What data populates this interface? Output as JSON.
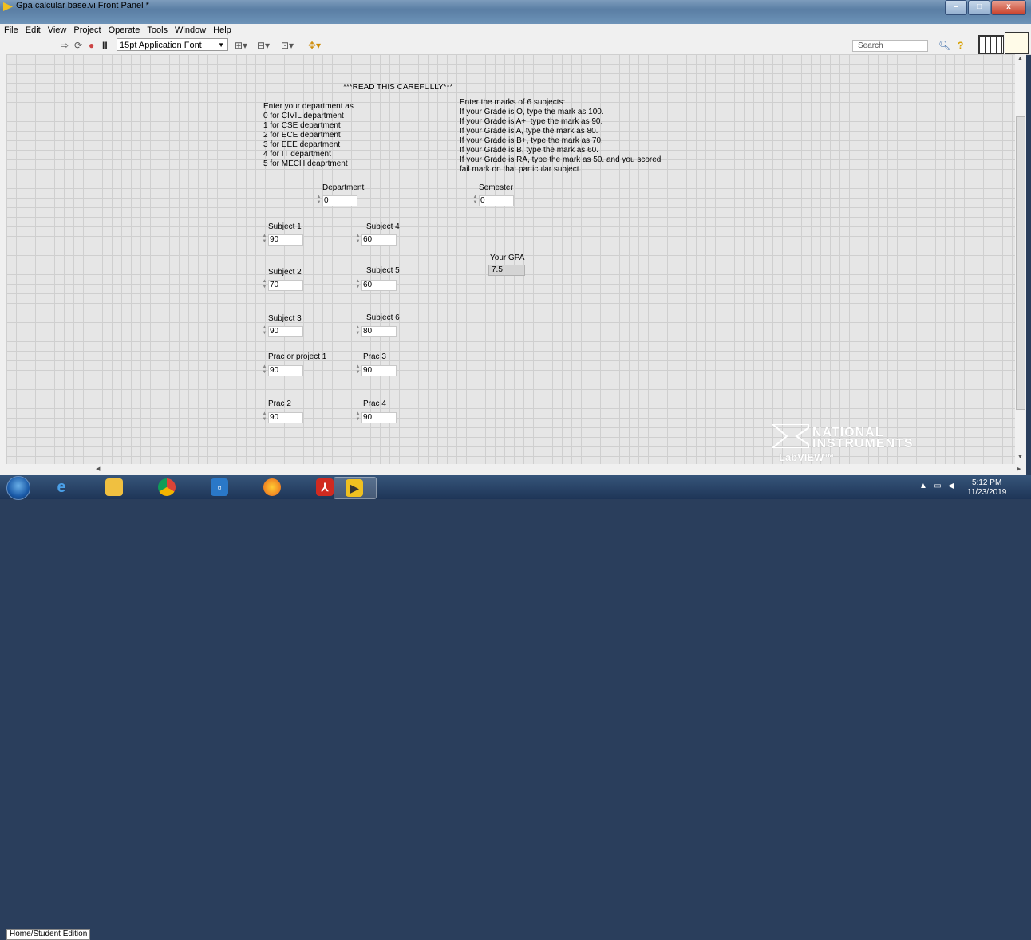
{
  "window": {
    "title": "Gpa calcular base.vi Front Panel *",
    "minimize": "–",
    "maximize": "□",
    "close": "x"
  },
  "menu": [
    "File",
    "Edit",
    "View",
    "Project",
    "Operate",
    "Tools",
    "Window",
    "Help"
  ],
  "toolbar": {
    "font_select": "15pt Application Font",
    "search_placeholder": "Search",
    "icons": [
      "run-arrow-icon",
      "run-continuously-icon",
      "abort-icon",
      "pause-icon",
      "align-icon",
      "distribute-icon",
      "resize-icon",
      "reorder-icon",
      "search-icon",
      "help-icon",
      "connector-pane-icon",
      "vi-icon"
    ]
  },
  "panel": {
    "heading": "***READ THIS CAREFULLY***",
    "dept_instructions": [
      "Enter your department as",
      "0 for CIVIL department",
      "1 for CSE department",
      "2 for ECE department",
      "3 for EEE department",
      "4 for IT  department",
      "5 for MECH deaprtment"
    ],
    "marks_instructions": [
      "Enter the marks of 6 subjects:",
      "If your Grade is O,  type the mark as 100.",
      "If your Grade is A+,  type the mark as 90.",
      "If your Grade is A,  type the mark as 80.",
      "If your Grade is B+,  type the mark as 70.",
      "If your Grade is B,  type the mark as 60.",
      "If your Grade is RA,  type the mark as 50. and you scored",
      " fail mark on that particular subject."
    ],
    "controls": {
      "department": {
        "label": "Department",
        "value": "0"
      },
      "semester": {
        "label": "Semester",
        "value": "0"
      },
      "subject1": {
        "label": "Subject 1",
        "value": "90"
      },
      "subject2": {
        "label": "Subject 2",
        "value": "70"
      },
      "subject3": {
        "label": "Subject 3",
        "value": "90"
      },
      "subject4": {
        "label": "Subject 4",
        "value": "60"
      },
      "subject5": {
        "label": "Subject 5",
        "value": "60"
      },
      "subject6": {
        "label": "Subject 6",
        "value": "80"
      },
      "prac1": {
        "label": "Prac or project 1",
        "value": "90"
      },
      "prac2": {
        "label": "Prac 2",
        "value": "90"
      },
      "prac3": {
        "label": "Prac 3",
        "value": "90"
      },
      "prac4": {
        "label": "Prac 4",
        "value": "90"
      }
    },
    "gpa": {
      "label": "Your GPA",
      "value": "7.5"
    }
  },
  "status_bar": {
    "edition": "Home/Student Edition"
  },
  "logo": {
    "line1": "NATIONAL",
    "line2": "INSTRUMENTS",
    "line3": "LabVIEW™ Home and Student Edition"
  },
  "taskbar": {
    "apps": [
      "internet-explorer-icon",
      "file-explorer-icon",
      "chrome-icon",
      "media-icon",
      "firefox-icon",
      "acrobat-icon",
      "labview-icon"
    ],
    "time": "5:12 PM",
    "date": "11/23/2019"
  }
}
